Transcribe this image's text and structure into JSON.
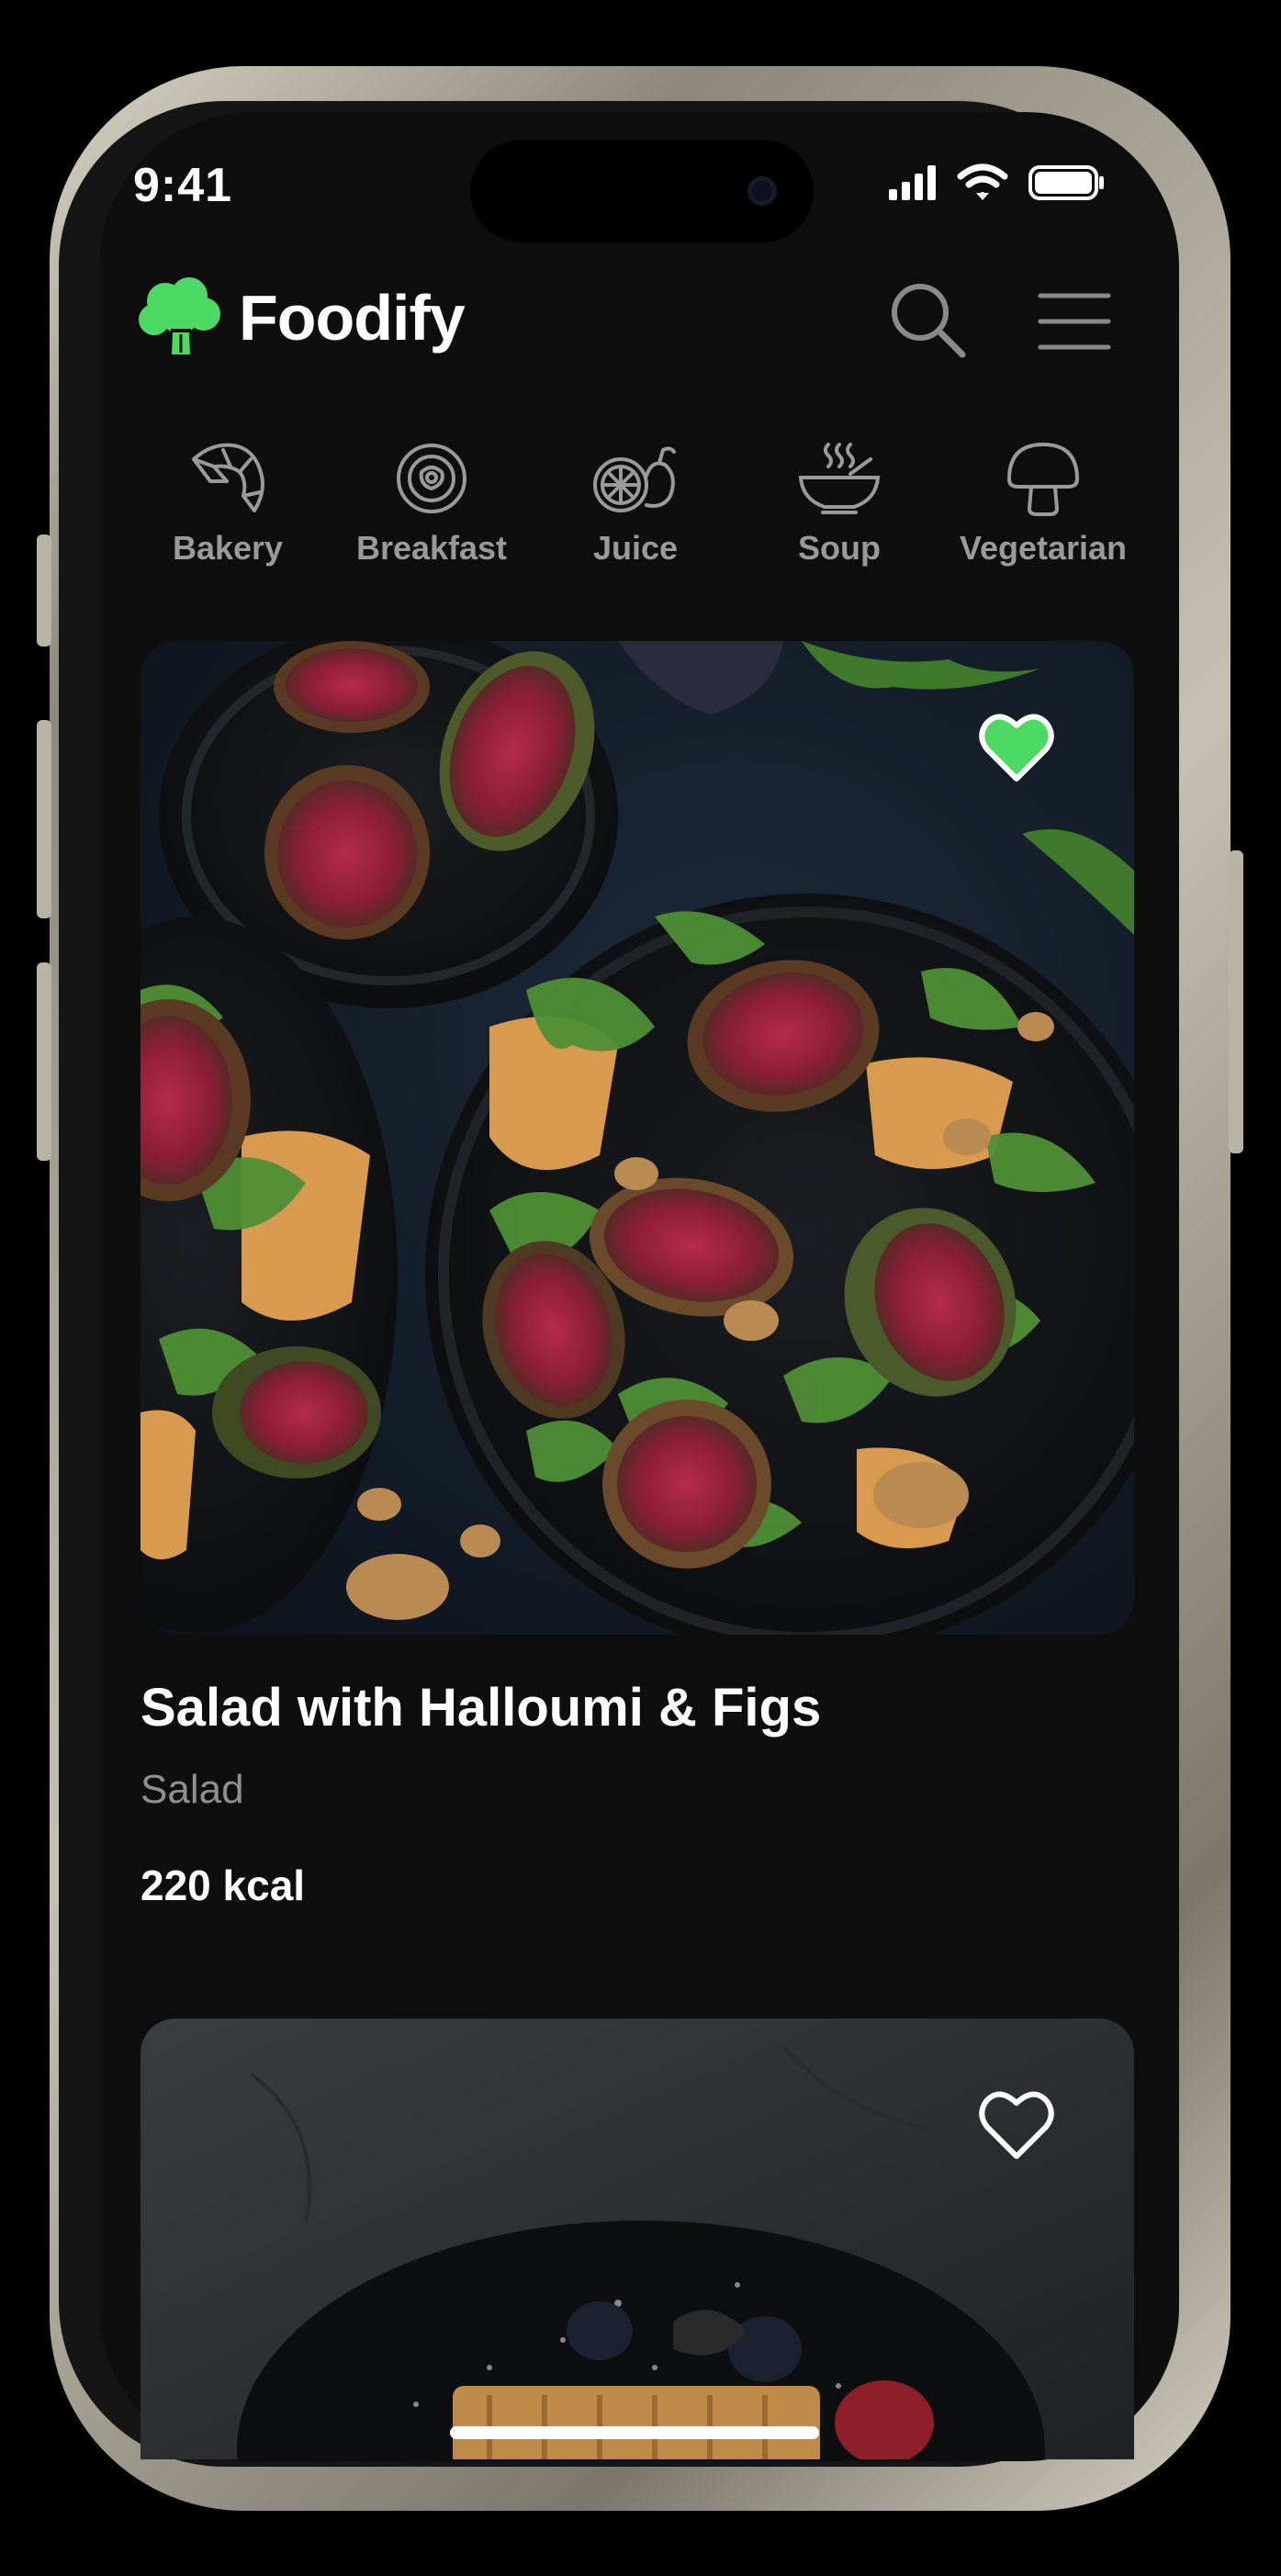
{
  "status_bar": {
    "time": "9:41"
  },
  "header": {
    "app_name": "Foodify"
  },
  "categories": [
    {
      "label": "Bakery",
      "icon": "croissant-icon"
    },
    {
      "label": "Breakfast",
      "icon": "plate-icon"
    },
    {
      "label": "Juice",
      "icon": "citrus-icon"
    },
    {
      "label": "Soup",
      "icon": "soup-bowl-icon"
    },
    {
      "label": "Vegetarian",
      "icon": "mushroom-icon"
    }
  ],
  "recipes": [
    {
      "title": "Salad with Halloumi & Figs",
      "category": "Salad",
      "calories": "220 kcal",
      "favorite": true
    },
    {
      "favorite": false
    }
  ],
  "colors": {
    "accent": "#4cd964",
    "background": "#0e0e0e",
    "muted_text": "#8f8f8f"
  }
}
